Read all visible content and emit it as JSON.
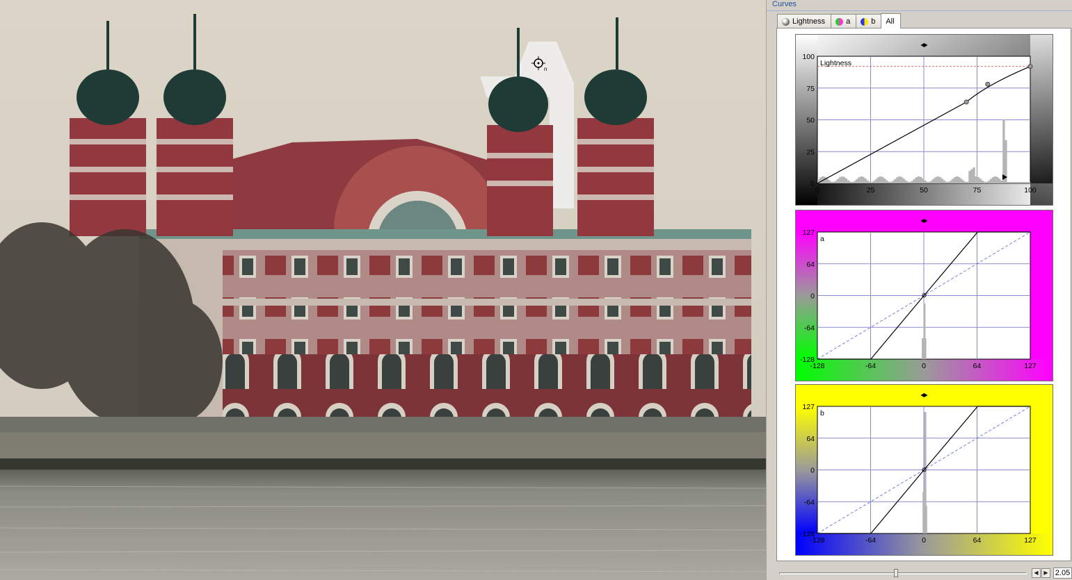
{
  "panel": {
    "title": "Curves",
    "tabs": [
      {
        "label": "Lightness",
        "icon": "lightness-icon"
      },
      {
        "label": "a",
        "icon": "a-channel-icon"
      },
      {
        "label": "b",
        "icon": "b-channel-icon"
      },
      {
        "label": "All",
        "icon": ""
      }
    ],
    "active_tab": "All",
    "slider_value": "2.05"
  },
  "curves": [
    {
      "channel": "Lightness",
      "label": "Lightness",
      "x_ticks": [
        "0",
        "25",
        "50",
        "75",
        "100"
      ],
      "y_ticks": [
        "100",
        "75",
        "50",
        "25",
        "0"
      ],
      "range": [
        0,
        100
      ],
      "control_points": [
        [
          0,
          0
        ],
        [
          70,
          64
        ],
        [
          80,
          78
        ],
        [
          100,
          92
        ]
      ],
      "bg_color_top": "#ffffff",
      "bg_color_bottom": "#000000"
    },
    {
      "channel": "a",
      "label": "a",
      "x_ticks": [
        "-128",
        "-64",
        "0",
        "64",
        "127"
      ],
      "y_ticks": [
        "127",
        "64",
        "0",
        "-64",
        "-128"
      ],
      "range": [
        -128,
        127
      ],
      "control_points": [
        [
          -128,
          -128
        ],
        [
          -64,
          -128
        ],
        [
          0,
          0
        ],
        [
          64,
          127
        ],
        [
          127,
          127
        ]
      ],
      "color_pos": "#ff00ff",
      "color_neg": "#00ff00"
    },
    {
      "channel": "b",
      "label": "b",
      "x_ticks": [
        "-128",
        "-64",
        "0",
        "64",
        "127"
      ],
      "y_ticks": [
        "127",
        "64",
        "0",
        "-64",
        "-128"
      ],
      "range": [
        -128,
        127
      ],
      "control_points": [
        [
          -128,
          -128
        ],
        [
          -64,
          -128
        ],
        [
          0,
          0
        ],
        [
          64,
          127
        ],
        [
          127,
          127
        ]
      ],
      "color_pos": "#ffff00",
      "color_neg": "#0000ff"
    }
  ]
}
